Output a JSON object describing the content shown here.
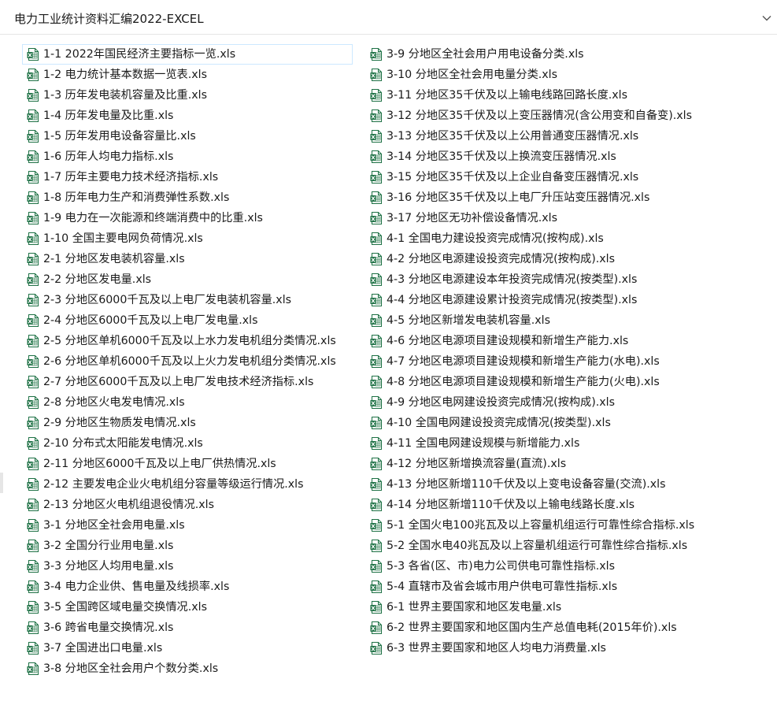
{
  "header": {
    "title": "电力工业统计资料汇编2022-EXCEL",
    "chevron_icon": "chevron-down-icon"
  },
  "icon": {
    "name": "excel-file-icon",
    "green": "#1e7145",
    "light": "#e8f3ec"
  },
  "colors": {
    "selection_border": "#cce8ff",
    "text": "#1a1a1a"
  },
  "files": {
    "left": [
      "1-1 2022年国民经济主要指标一览.xls",
      "1-2 电力统计基本数据一览表.xls",
      "1-3 历年发电装机容量及比重.xls",
      "1-4 历年发电量及比重.xls",
      "1-5 历年发用电设备容量比.xls",
      "1-6 历年人均电力指标.xls",
      "1-7 历年主要电力技术经济指标.xls",
      "1-8 历年电力生产和消费弹性系数.xls",
      "1-9 电力在一次能源和终端消费中的比重.xls",
      "1-10 全国主要电网负荷情况.xls",
      "2-1 分地区发电装机容量.xls",
      "2-2 分地区发电量.xls",
      "2-3 分地区6000千瓦及以上电厂发电装机容量.xls",
      "2-4 分地区6000千瓦及以上电厂发电量.xls",
      "2-5 分地区单机6000千瓦及以上水力发电机组分类情况.xls",
      "2-6 分地区单机6000千瓦及以上火力发电机组分类情况.xls",
      "2-7 分地区6000千瓦及以上电厂发电技术经济指标.xls",
      "2-8 分地区火电发电情况.xls",
      "2-9 分地区生物质发电情况.xls",
      "2-10 分布式太阳能发电情况.xls",
      "2-11 分地区6000千瓦及以上电厂供热情况.xls",
      "2-12 主要发电企业火电机组分容量等级运行情况.xls",
      "2-13 分地区火电机组退役情况.xls",
      "3-1 分地区全社会用电量.xls",
      "3-2 全国分行业用电量.xls",
      "3-3 分地区人均用电量.xls",
      "3-4 电力企业供、售电量及线损率.xls",
      "3-5 全国跨区域电量交换情况.xls",
      "3-6 跨省电量交换情况.xls",
      "3-7 全国进出口电量.xls",
      "3-8 分地区全社会用户个数分类.xls"
    ],
    "right": [
      "3-9 分地区全社会用户用电设备分类.xls",
      "3-10 分地区全社会用电量分类.xls",
      "3-11 分地区35千伏及以上输电线路回路长度.xls",
      "3-12 分地区35千伏及以上变压器情况(含公用变和自备变).xls",
      "3-13 分地区35千伏及以上公用普通变压器情况.xls",
      "3-14 分地区35千伏及以上换流变压器情况.xls",
      "3-15 分地区35千伏及以上企业自备变压器情况.xls",
      "3-16 分地区35千伏及以上电厂升压站变压器情况.xls",
      "3-17 分地区无功补偿设备情况.xls",
      "4-1 全国电力建设投资完成情况(按构成).xls",
      "4-2 分地区电源建设投资完成情况(按构成).xls",
      "4-3 分地区电源建设本年投资完成情况(按类型).xls",
      "4-4 分地区电源建设累计投资完成情况(按类型).xls",
      "4-5 分地区新增发电装机容量.xls",
      "4-6 分地区电源项目建设规模和新增生产能力.xls",
      "4-7 分地区电源项目建设规模和新增生产能力(水电).xls",
      "4-8 分地区电源项目建设规模和新增生产能力(火电).xls",
      "4-9 分地区电网建设投资完成情况(按构成).xls",
      "4-10 全国电网建设投资完成情况(按类型).xls",
      "4-11 全国电网建设规模与新增能力.xls",
      "4-12 分地区新增换流容量(直流).xls",
      "4-13 分地区新增110千伏及以上变电设备容量(交流).xls",
      "4-14 分地区新增110千伏及以上输电线路长度.xls",
      "5-1 全国火电100兆瓦及以上容量机组运行可靠性综合指标.xls",
      "5-2 全国水电40兆瓦及以上容量机组运行可靠性综合指标.xls",
      "5-3 各省(区、市)电力公司供电可靠性指标.xls",
      "5-4 直辖市及省会城市用户供电可靠性指标.xls",
      "6-1 世界主要国家和地区发电量.xls",
      "6-2 世界主要国家和地区国内生产总值电耗(2015年价).xls",
      "6-3 世界主要国家和地区人均电力消费量.xls"
    ]
  }
}
